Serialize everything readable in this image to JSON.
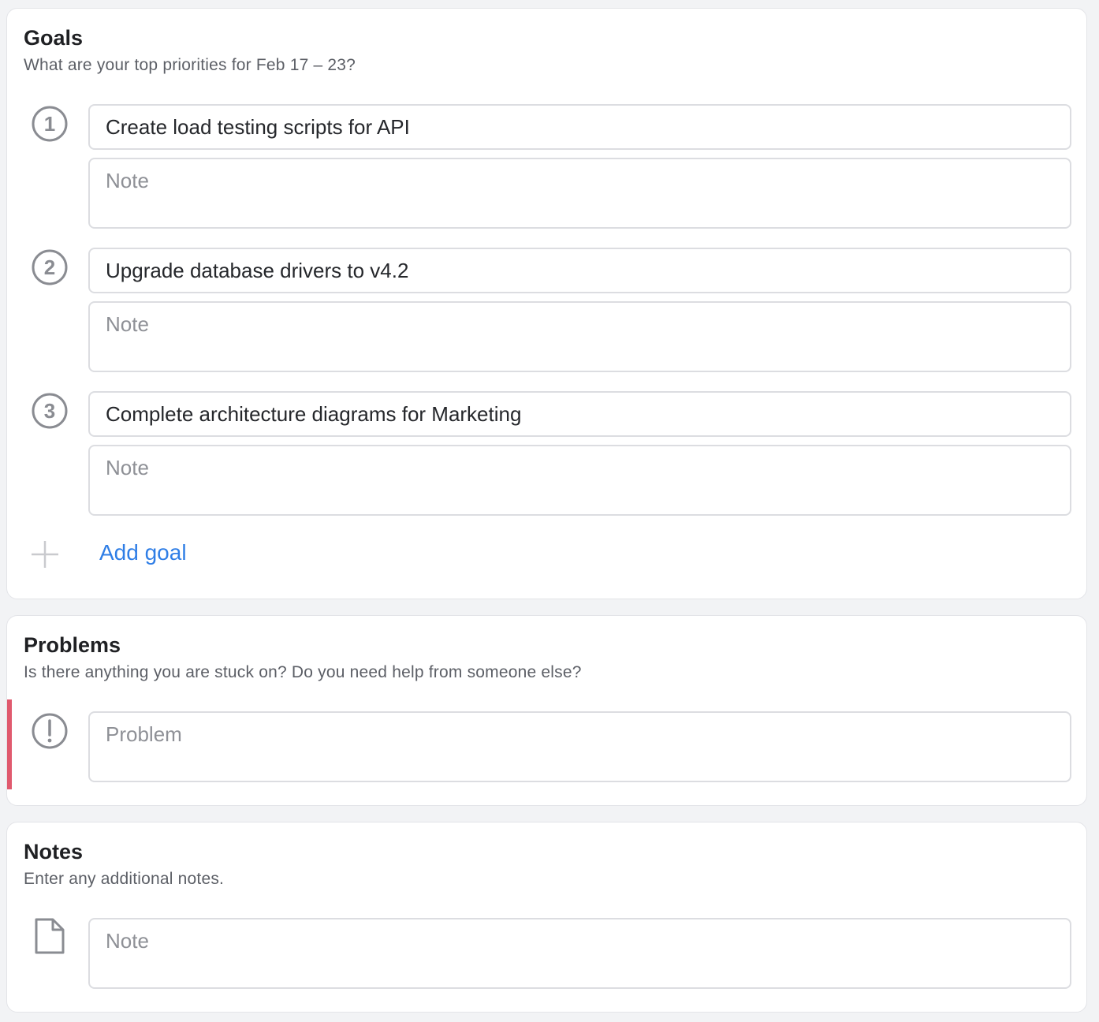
{
  "goals": {
    "title": "Goals",
    "subtitle": "What are your top priorities for Feb 17 – 23?",
    "items": [
      {
        "number": "1",
        "value": "Create load testing scripts for API",
        "note_placeholder": "Note"
      },
      {
        "number": "2",
        "value": "Upgrade database drivers to v4.2",
        "note_placeholder": "Note"
      },
      {
        "number": "3",
        "value": "Complete architecture diagrams for Marketing",
        "note_placeholder": "Note"
      }
    ],
    "add_label": "Add goal"
  },
  "problems": {
    "title": "Problems",
    "subtitle": "Is there anything you are stuck on? Do you need help from someone else?",
    "placeholder": "Problem",
    "accent": "#e05a6e"
  },
  "notes": {
    "title": "Notes",
    "subtitle": "Enter any additional notes.",
    "placeholder": "Note"
  },
  "colors": {
    "link": "#2f7ee6",
    "icon_gray": "#8a8c92",
    "border": "#dcdde1"
  },
  "icons": {
    "goal_number": "circled-number-icon",
    "add": "plus-icon",
    "problem": "exclamation-circle-icon",
    "note": "document-icon"
  }
}
